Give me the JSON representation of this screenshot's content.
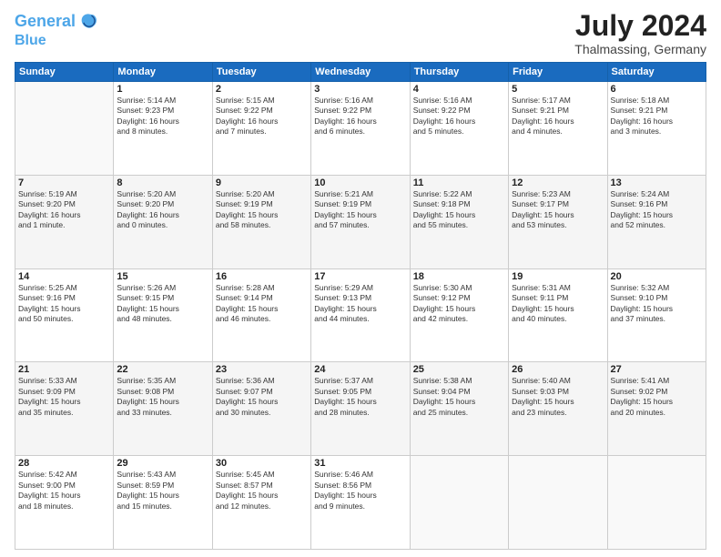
{
  "header": {
    "logo_line1": "General",
    "logo_line2": "Blue",
    "month": "July 2024",
    "location": "Thalmassing, Germany"
  },
  "weekdays": [
    "Sunday",
    "Monday",
    "Tuesday",
    "Wednesday",
    "Thursday",
    "Friday",
    "Saturday"
  ],
  "weeks": [
    [
      {
        "day": "",
        "info": ""
      },
      {
        "day": "1",
        "info": "Sunrise: 5:14 AM\nSunset: 9:23 PM\nDaylight: 16 hours\nand 8 minutes."
      },
      {
        "day": "2",
        "info": "Sunrise: 5:15 AM\nSunset: 9:22 PM\nDaylight: 16 hours\nand 7 minutes."
      },
      {
        "day": "3",
        "info": "Sunrise: 5:16 AM\nSunset: 9:22 PM\nDaylight: 16 hours\nand 6 minutes."
      },
      {
        "day": "4",
        "info": "Sunrise: 5:16 AM\nSunset: 9:22 PM\nDaylight: 16 hours\nand 5 minutes."
      },
      {
        "day": "5",
        "info": "Sunrise: 5:17 AM\nSunset: 9:21 PM\nDaylight: 16 hours\nand 4 minutes."
      },
      {
        "day": "6",
        "info": "Sunrise: 5:18 AM\nSunset: 9:21 PM\nDaylight: 16 hours\nand 3 minutes."
      }
    ],
    [
      {
        "day": "7",
        "info": "Sunrise: 5:19 AM\nSunset: 9:20 PM\nDaylight: 16 hours\nand 1 minute."
      },
      {
        "day": "8",
        "info": "Sunrise: 5:20 AM\nSunset: 9:20 PM\nDaylight: 16 hours\nand 0 minutes."
      },
      {
        "day": "9",
        "info": "Sunrise: 5:20 AM\nSunset: 9:19 PM\nDaylight: 15 hours\nand 58 minutes."
      },
      {
        "day": "10",
        "info": "Sunrise: 5:21 AM\nSunset: 9:19 PM\nDaylight: 15 hours\nand 57 minutes."
      },
      {
        "day": "11",
        "info": "Sunrise: 5:22 AM\nSunset: 9:18 PM\nDaylight: 15 hours\nand 55 minutes."
      },
      {
        "day": "12",
        "info": "Sunrise: 5:23 AM\nSunset: 9:17 PM\nDaylight: 15 hours\nand 53 minutes."
      },
      {
        "day": "13",
        "info": "Sunrise: 5:24 AM\nSunset: 9:16 PM\nDaylight: 15 hours\nand 52 minutes."
      }
    ],
    [
      {
        "day": "14",
        "info": "Sunrise: 5:25 AM\nSunset: 9:16 PM\nDaylight: 15 hours\nand 50 minutes."
      },
      {
        "day": "15",
        "info": "Sunrise: 5:26 AM\nSunset: 9:15 PM\nDaylight: 15 hours\nand 48 minutes."
      },
      {
        "day": "16",
        "info": "Sunrise: 5:28 AM\nSunset: 9:14 PM\nDaylight: 15 hours\nand 46 minutes."
      },
      {
        "day": "17",
        "info": "Sunrise: 5:29 AM\nSunset: 9:13 PM\nDaylight: 15 hours\nand 44 minutes."
      },
      {
        "day": "18",
        "info": "Sunrise: 5:30 AM\nSunset: 9:12 PM\nDaylight: 15 hours\nand 42 minutes."
      },
      {
        "day": "19",
        "info": "Sunrise: 5:31 AM\nSunset: 9:11 PM\nDaylight: 15 hours\nand 40 minutes."
      },
      {
        "day": "20",
        "info": "Sunrise: 5:32 AM\nSunset: 9:10 PM\nDaylight: 15 hours\nand 37 minutes."
      }
    ],
    [
      {
        "day": "21",
        "info": "Sunrise: 5:33 AM\nSunset: 9:09 PM\nDaylight: 15 hours\nand 35 minutes."
      },
      {
        "day": "22",
        "info": "Sunrise: 5:35 AM\nSunset: 9:08 PM\nDaylight: 15 hours\nand 33 minutes."
      },
      {
        "day": "23",
        "info": "Sunrise: 5:36 AM\nSunset: 9:07 PM\nDaylight: 15 hours\nand 30 minutes."
      },
      {
        "day": "24",
        "info": "Sunrise: 5:37 AM\nSunset: 9:05 PM\nDaylight: 15 hours\nand 28 minutes."
      },
      {
        "day": "25",
        "info": "Sunrise: 5:38 AM\nSunset: 9:04 PM\nDaylight: 15 hours\nand 25 minutes."
      },
      {
        "day": "26",
        "info": "Sunrise: 5:40 AM\nSunset: 9:03 PM\nDaylight: 15 hours\nand 23 minutes."
      },
      {
        "day": "27",
        "info": "Sunrise: 5:41 AM\nSunset: 9:02 PM\nDaylight: 15 hours\nand 20 minutes."
      }
    ],
    [
      {
        "day": "28",
        "info": "Sunrise: 5:42 AM\nSunset: 9:00 PM\nDaylight: 15 hours\nand 18 minutes."
      },
      {
        "day": "29",
        "info": "Sunrise: 5:43 AM\nSunset: 8:59 PM\nDaylight: 15 hours\nand 15 minutes."
      },
      {
        "day": "30",
        "info": "Sunrise: 5:45 AM\nSunset: 8:57 PM\nDaylight: 15 hours\nand 12 minutes."
      },
      {
        "day": "31",
        "info": "Sunrise: 5:46 AM\nSunset: 8:56 PM\nDaylight: 15 hours\nand 9 minutes."
      },
      {
        "day": "",
        "info": ""
      },
      {
        "day": "",
        "info": ""
      },
      {
        "day": "",
        "info": ""
      }
    ]
  ]
}
